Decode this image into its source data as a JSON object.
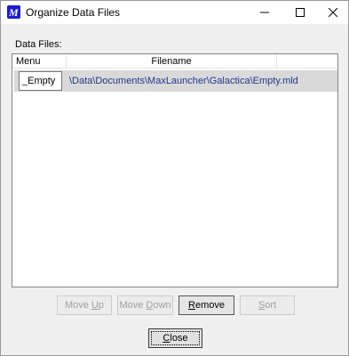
{
  "window": {
    "title": "Organize Data Files",
    "app_icon_letter": "M",
    "accent": "#1b1bd6"
  },
  "label": {
    "data_files": "Data Files:"
  },
  "list": {
    "columns": [
      "Menu Name",
      "Filename"
    ],
    "rows": [
      {
        "menu_name": "_Empty",
        "filename": "\\Data\\Documents\\MaxLauncher\\Galactica\\Empty.mld"
      }
    ]
  },
  "buttons": {
    "move_up": {
      "pre": "Move ",
      "mnemonic": "U",
      "post": "p"
    },
    "move_down": {
      "pre": "Move ",
      "mnemonic": "D",
      "post": "own"
    },
    "remove": {
      "pre": "",
      "mnemonic": "R",
      "post": "emove"
    },
    "sort": {
      "pre": "",
      "mnemonic": "S",
      "post": "ort"
    },
    "close": {
      "pre": "",
      "mnemonic": "C",
      "post": "lose"
    }
  }
}
